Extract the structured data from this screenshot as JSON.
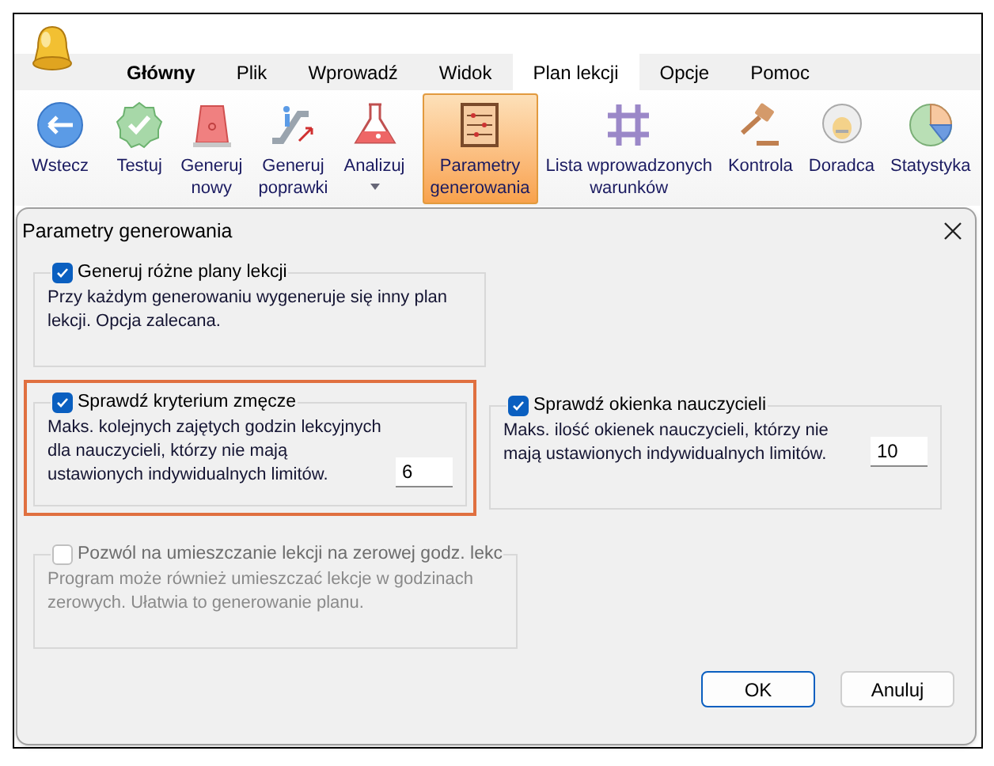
{
  "ribbon": {
    "tabs": [
      {
        "label": "Główny",
        "selected": false,
        "emphasized": true
      },
      {
        "label": "Plik",
        "selected": false,
        "emphasized": false
      },
      {
        "label": "Wprowadź",
        "selected": false,
        "emphasized": false
      },
      {
        "label": "Widok",
        "selected": false,
        "emphasized": false
      },
      {
        "label": "Plan lekcji",
        "selected": true,
        "emphasized": false
      },
      {
        "label": "Opcje",
        "selected": false,
        "emphasized": false
      },
      {
        "label": "Pomoc",
        "selected": false,
        "emphasized": false
      }
    ],
    "buttons": [
      {
        "kind": "back",
        "lines": [
          "Wstecz"
        ],
        "selected": false,
        "dropdown": false
      },
      {
        "kind": "separator"
      },
      {
        "kind": "check",
        "lines": [
          "Testuj"
        ],
        "selected": false,
        "dropdown": false
      },
      {
        "kind": "alarm",
        "lines": [
          "Generuj",
          "nowy"
        ],
        "selected": false,
        "dropdown": false
      },
      {
        "kind": "escalator",
        "lines": [
          "Generuj",
          "poprawki"
        ],
        "selected": false,
        "dropdown": false
      },
      {
        "kind": "flask",
        "lines": [
          "Analizuj"
        ],
        "selected": false,
        "dropdown": true
      },
      {
        "kind": "separator"
      },
      {
        "kind": "abacus",
        "lines": [
          "Parametry",
          "generowania"
        ],
        "selected": true,
        "dropdown": false
      },
      {
        "kind": "grid",
        "lines": [
          "Lista wprowadzonych",
          "warunków"
        ],
        "selected": false,
        "dropdown": false
      },
      {
        "kind": "gavel",
        "lines": [
          "Kontrola"
        ],
        "selected": false,
        "dropdown": false
      },
      {
        "kind": "advisor",
        "lines": [
          "Doradca"
        ],
        "selected": false,
        "dropdown": false
      },
      {
        "kind": "pie",
        "lines": [
          "Statystyka"
        ],
        "selected": false,
        "dropdown": false
      },
      {
        "kind": "separator"
      }
    ]
  },
  "dialog": {
    "title": "Parametry generowania",
    "rows": [
      [
        {
          "label": "Generuj różne plany lekcji",
          "checked": true,
          "disabled": false,
          "highlighted": false,
          "description": "Przy każdym generowaniu wygeneruje się inny plan lekcji. Opcja zalecana."
        }
      ],
      [
        {
          "label": "Sprawdź kryterium zmęcze",
          "checked": true,
          "disabled": false,
          "highlighted": true,
          "description": "Maks. kolejnych zajętych godzin lekcyjnych dla nauczycieli, którzy nie mają ustawionych indywidualnych limitów.",
          "value": "6"
        },
        {
          "label": "Sprawdź okienka nauczycieli",
          "checked": true,
          "disabled": false,
          "highlighted": false,
          "description": "Maks. ilość okienek nauczycieli, którzy nie mają ustawionych indywidualnych limitów.",
          "value": "10"
        }
      ],
      [
        {
          "label": "Pozwól na umieszczanie lekcji na zerowej godz. lekc",
          "checked": false,
          "disabled": true,
          "highlighted": false,
          "description": "Program może również umieszczać lekcje w godzinach zerowych. Ułatwia to generowanie planu."
        }
      ]
    ],
    "buttons": [
      {
        "label": "OK",
        "default": true
      },
      {
        "label": "Anuluj",
        "default": false
      }
    ]
  }
}
